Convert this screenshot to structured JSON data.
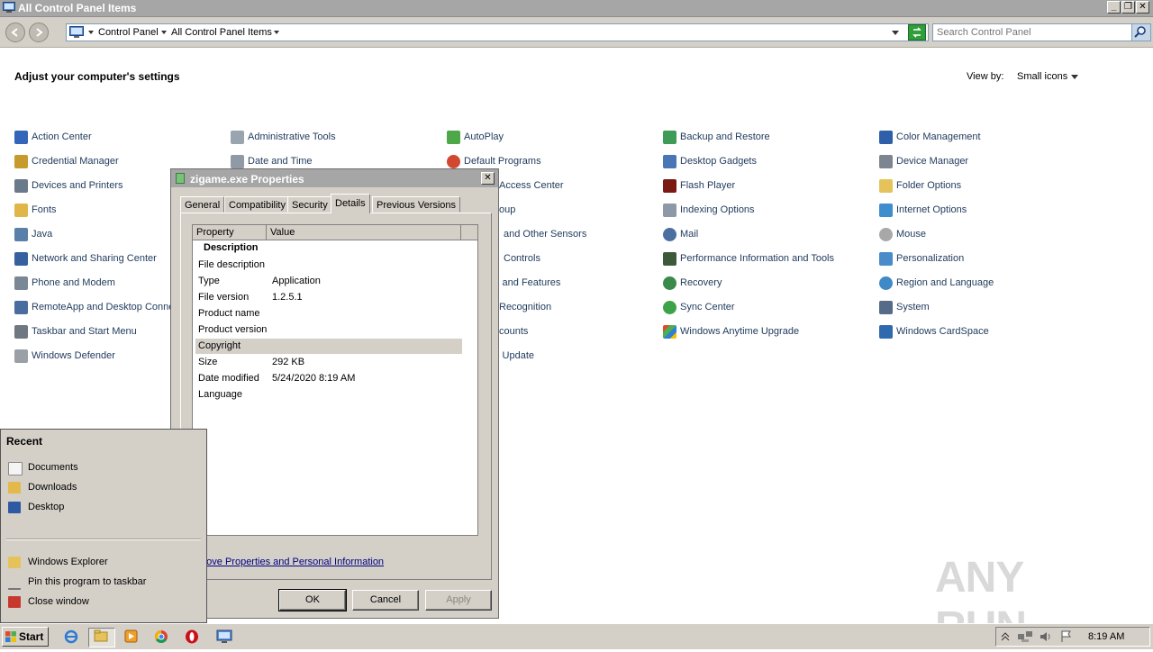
{
  "window": {
    "title": "All Control Panel Items"
  },
  "address": {
    "crumbs": [
      "Control Panel",
      "All Control Panel Items"
    ],
    "search_placeholder": "Search Control Panel"
  },
  "header": {
    "title": "Adjust your computer's settings",
    "view_by_label": "View by:",
    "view_by_value": "Small icons"
  },
  "items": [
    "Action Center",
    "Administrative Tools",
    "AutoPlay",
    "Backup and Restore",
    "Color Management",
    "Credential Manager",
    "Date and Time",
    "Default Programs",
    "Desktop Gadgets",
    "Device Manager",
    "Devices and Printers",
    "Access Center",
    "Flash Player",
    "Folder Options",
    "Fonts",
    "oup",
    "Indexing Options",
    "Internet Options",
    "Java",
    "and Other Sensors",
    "Mail",
    "Mouse",
    "Network and Sharing Center",
    "Controls",
    "Performance Information and Tools",
    "Personalization",
    "Phone and Modem",
    "s and Features",
    "Recovery",
    "Region and Language",
    "RemoteApp and Desktop Conne",
    "Recognition",
    "Sync Center",
    "System",
    "Taskbar and Start Menu",
    "counts",
    "Windows Anytime Upgrade",
    "Windows CardSpace",
    "Windows Defender",
    "s Update"
  ],
  "dialog": {
    "title": "zigame.exe Properties",
    "tabs": [
      "General",
      "Compatibility",
      "Security",
      "Details",
      "Previous Versions"
    ],
    "columns": {
      "property": "Property",
      "value": "Value"
    },
    "group": "Description",
    "rows": [
      {
        "k": "File description",
        "v": ""
      },
      {
        "k": "Type",
        "v": "Application"
      },
      {
        "k": "File version",
        "v": "1.2.5.1"
      },
      {
        "k": "Product name",
        "v": ""
      },
      {
        "k": "Product version",
        "v": ""
      },
      {
        "k": "Copyright",
        "v": ""
      },
      {
        "k": "Size",
        "v": "292 KB"
      },
      {
        "k": "Date modified",
        "v": "5/24/2020 8:19 AM"
      },
      {
        "k": "Language",
        "v": ""
      }
    ],
    "remove_link": "move Properties and Personal Information",
    "buttons": {
      "ok": "OK",
      "cancel": "Cancel",
      "apply": "Apply"
    }
  },
  "jumplist": {
    "recent_title": "Recent",
    "recent": [
      "Documents",
      "Downloads",
      "Desktop"
    ],
    "tasks": [
      "Windows Explorer",
      "Pin this program to taskbar",
      "Close window"
    ]
  },
  "taskbar": {
    "start": "Start",
    "clock": "8:19 AM"
  },
  "watermark": "ANY RUN"
}
